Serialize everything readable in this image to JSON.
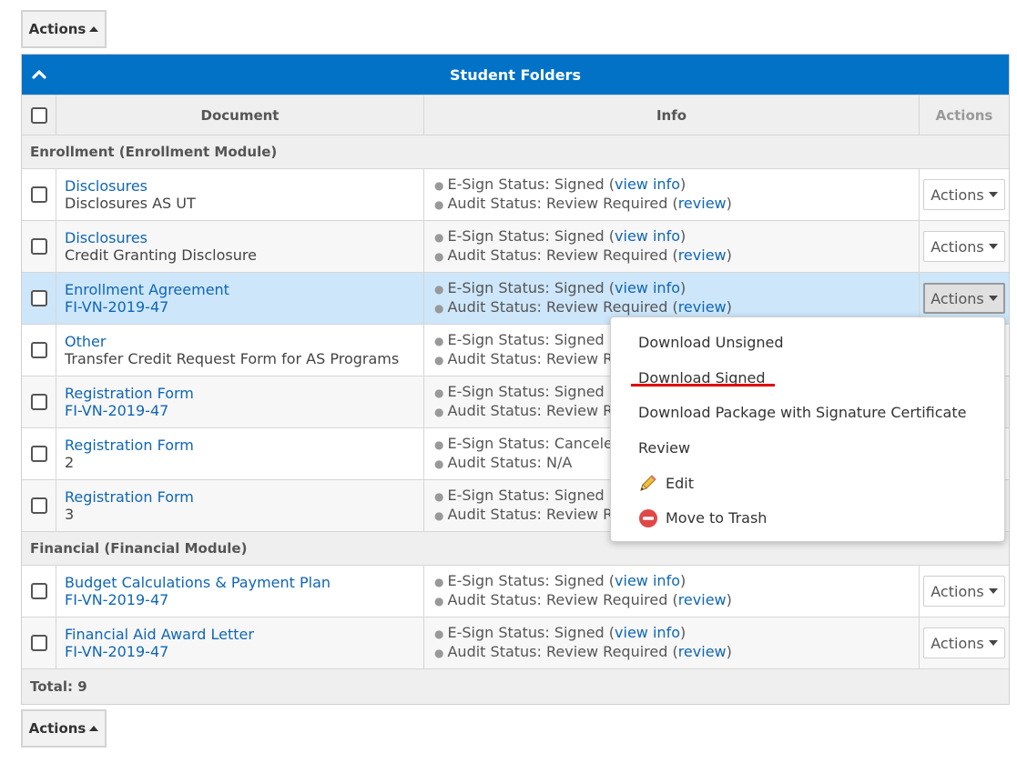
{
  "top_actions": {
    "label": "Actions"
  },
  "bottom_actions": {
    "label": "Actions"
  },
  "grid": {
    "title": "Student Folders",
    "columns": {
      "document": "Document",
      "info": "Info",
      "actions": "Actions"
    },
    "groups": [
      {
        "name": "Enrollment (Enrollment Module)",
        "rows": [
          {
            "title": "Disclosures",
            "subtitle": "Disclosures AS UT",
            "esign_label": "E-Sign Status: Signed (",
            "esign_link": "view info",
            "esign_end": ")",
            "audit_label": "Audit Status: Review Required (",
            "audit_link": "review",
            "audit_end": ")",
            "actions": "Actions"
          },
          {
            "title": "Disclosures",
            "subtitle": "Credit Granting Disclosure",
            "esign_label": "E-Sign Status: Signed (",
            "esign_link": "view info",
            "esign_end": ")",
            "audit_label": "Audit Status: Review Required (",
            "audit_link": "review",
            "audit_end": ")",
            "actions": "Actions"
          },
          {
            "title": "Enrollment Agreement",
            "subtitle": "FI-VN-2019-47",
            "esign_label": "E-Sign Status: Signed (",
            "esign_link": "view info",
            "esign_end": ")",
            "audit_label": "Audit Status: Review Required (",
            "audit_link": "review",
            "audit_end": ")",
            "actions": "Actions"
          },
          {
            "title": "Other",
            "subtitle": "Transfer Credit Request Form for AS Programs",
            "esign_label": "E-Sign Status: Signed",
            "audit_label": "Audit Status: Review R"
          },
          {
            "title": "Registration Form",
            "subtitle": "FI-VN-2019-47",
            "esign_label": "E-Sign Status: Signed",
            "audit_label": "Audit Status: Review R"
          },
          {
            "title": "Registration Form",
            "subtitle": "2",
            "esign_label": "E-Sign Status: Cancele",
            "audit_label": "Audit Status: N/A"
          },
          {
            "title": "Registration Form",
            "subtitle": "3",
            "esign_label": "E-Sign Status: Signed",
            "audit_label": "Audit Status: Review R"
          }
        ]
      },
      {
        "name": "Financial (Financial Module)",
        "rows": [
          {
            "title": "Budget Calculations & Payment Plan",
            "subtitle": "FI-VN-2019-47",
            "esign_label": "E-Sign Status: Signed (",
            "esign_link": "view info",
            "esign_end": ")",
            "audit_label": "Audit Status: Review Required (",
            "audit_link": "review",
            "audit_end": ")",
            "actions": "Actions"
          },
          {
            "title": "Financial Aid Award Letter",
            "subtitle": "FI-VN-2019-47",
            "esign_label": "E-Sign Status: Signed (",
            "esign_link": "view info",
            "esign_end": ")",
            "audit_label": "Audit Status: Review Required (",
            "audit_link": "review",
            "audit_end": ")",
            "actions": "Actions"
          }
        ]
      }
    ],
    "total": "Total: 9"
  },
  "dropdown": {
    "items": [
      {
        "label": "Download Unsigned",
        "icon": ""
      },
      {
        "label": "Download Signed",
        "icon": ""
      },
      {
        "label": "Download Package with Signature Certificate",
        "icon": ""
      },
      {
        "label": "Review",
        "icon": ""
      },
      {
        "label": "Edit",
        "icon": "pencil-icon"
      },
      {
        "label": "Move to Trash",
        "icon": "trash-minus-icon"
      }
    ]
  },
  "colors": {
    "header_blue": "#0272c6",
    "link_blue": "#0f66b5",
    "highlight_row": "#cde6fa",
    "annotation_red": "#e00000"
  }
}
